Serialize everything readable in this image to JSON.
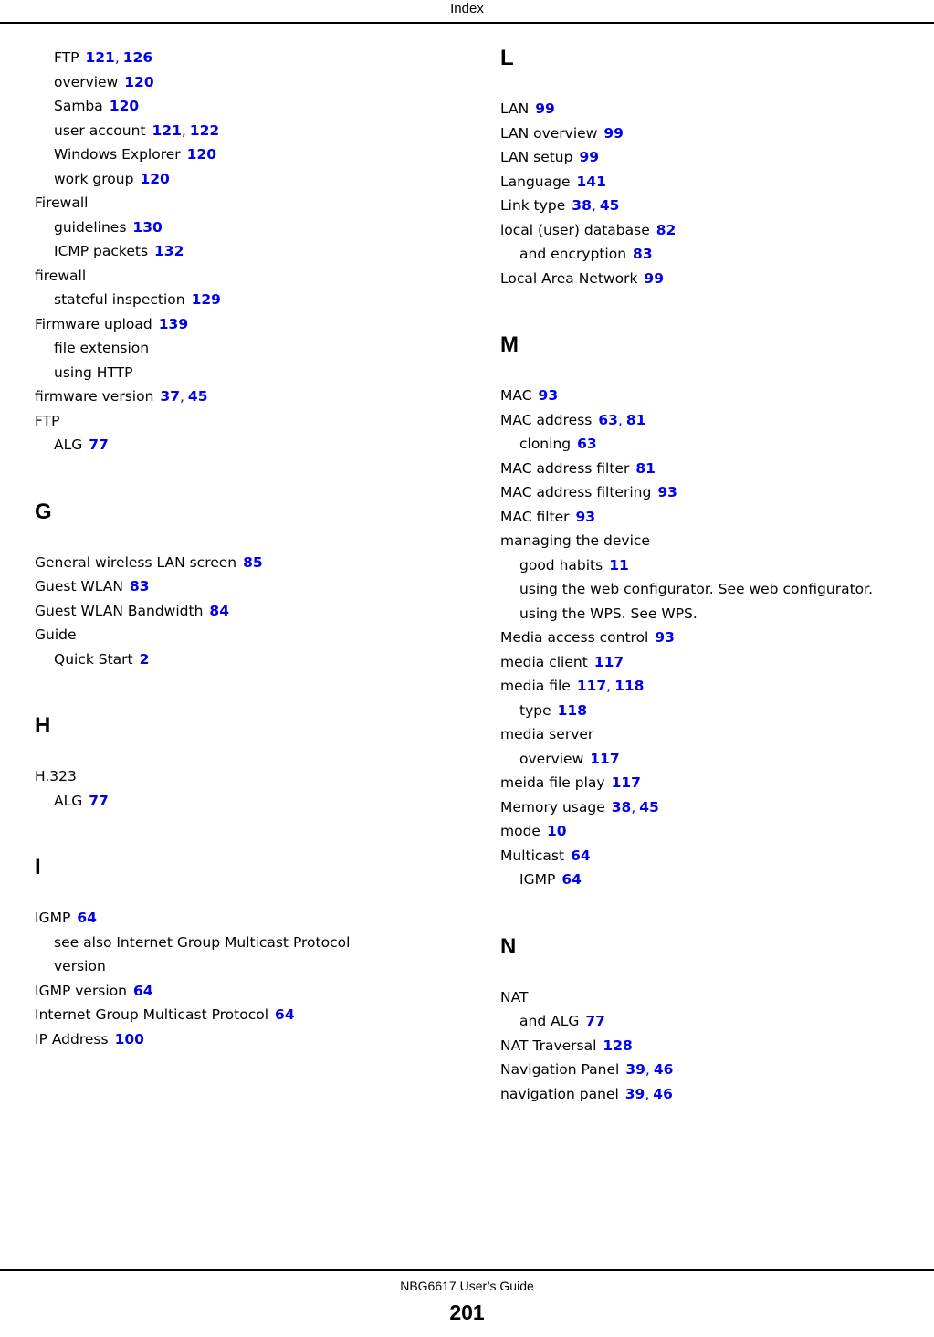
{
  "header": {
    "title": "Index"
  },
  "footer": {
    "guide": "NBG6617 User’s Guide",
    "page_number": "201"
  },
  "colors": {
    "page_link": "#0000ee",
    "text": "#000000",
    "background": "#ffffff"
  },
  "left_column": [
    {
      "type": "entries",
      "items": [
        {
          "level": 1,
          "term": "FTP",
          "pages": [
            "121",
            "126"
          ]
        },
        {
          "level": 1,
          "term": "overview",
          "pages": [
            "120"
          ]
        },
        {
          "level": 1,
          "term": "Samba",
          "pages": [
            "120"
          ]
        },
        {
          "level": 1,
          "term": "user account",
          "pages": [
            "121",
            "122"
          ]
        },
        {
          "level": 1,
          "term": "Windows Explorer",
          "pages": [
            "120"
          ]
        },
        {
          "level": 1,
          "term": "work group",
          "pages": [
            "120"
          ]
        },
        {
          "level": 0,
          "term": "Firewall",
          "pages": []
        },
        {
          "level": 1,
          "term": "guidelines",
          "pages": [
            "130"
          ]
        },
        {
          "level": 1,
          "term": "ICMP packets",
          "pages": [
            "132"
          ]
        },
        {
          "level": 0,
          "term": "firewall",
          "pages": []
        },
        {
          "level": 1,
          "term": "stateful inspection",
          "pages": [
            "129"
          ]
        },
        {
          "level": 0,
          "term": "Firmware upload",
          "pages": [
            "139"
          ]
        },
        {
          "level": 1,
          "term": "file extension",
          "pages": []
        },
        {
          "level": 1,
          "term": "using HTTP",
          "pages": []
        },
        {
          "level": 0,
          "term": "firmware version",
          "pages": [
            "37",
            "45"
          ]
        },
        {
          "level": 0,
          "term": "FTP",
          "pages": []
        },
        {
          "level": 1,
          "term": "ALG",
          "pages": [
            "77"
          ]
        }
      ]
    },
    {
      "type": "section",
      "letter": "G",
      "items": [
        {
          "level": 0,
          "term": "General wireless LAN screen",
          "pages": [
            "85"
          ]
        },
        {
          "level": 0,
          "term": "Guest WLAN",
          "pages": [
            "83"
          ]
        },
        {
          "level": 0,
          "term": "Guest WLAN Bandwidth",
          "pages": [
            "84"
          ]
        },
        {
          "level": 0,
          "term": "Guide",
          "pages": []
        },
        {
          "level": 1,
          "term": "Quick Start",
          "pages": [
            "2"
          ]
        }
      ]
    },
    {
      "type": "section",
      "letter": "H",
      "items": [
        {
          "level": 0,
          "term": "H.323",
          "pages": []
        },
        {
          "level": 1,
          "term": "ALG",
          "pages": [
            "77"
          ]
        }
      ]
    },
    {
      "type": "section",
      "letter": "I",
      "items": [
        {
          "level": 0,
          "term": "IGMP",
          "pages": [
            "64"
          ]
        },
        {
          "level": 1,
          "term": "see also Internet Group Multicast Protocol",
          "pages": []
        },
        {
          "level": 1,
          "term": "version",
          "pages": []
        },
        {
          "level": 0,
          "term": "IGMP version",
          "pages": [
            "64"
          ]
        },
        {
          "level": 0,
          "term": "Internet Group Multicast Protocol",
          "pages": [
            "64"
          ]
        },
        {
          "level": 0,
          "term": "IP Address",
          "pages": [
            "100"
          ]
        }
      ]
    }
  ],
  "right_column": [
    {
      "type": "section",
      "letter": "L",
      "first": true,
      "items": [
        {
          "level": 0,
          "term": "LAN",
          "pages": [
            "99"
          ]
        },
        {
          "level": 0,
          "term": "LAN overview",
          "pages": [
            "99"
          ]
        },
        {
          "level": 0,
          "term": "LAN setup",
          "pages": [
            "99"
          ]
        },
        {
          "level": 0,
          "term": "Language",
          "pages": [
            "141"
          ]
        },
        {
          "level": 0,
          "term": "Link type",
          "pages": [
            "38",
            "45"
          ]
        },
        {
          "level": 0,
          "term": "local (user) database",
          "pages": [
            "82"
          ]
        },
        {
          "level": 1,
          "term": "and encryption",
          "pages": [
            "83"
          ]
        },
        {
          "level": 0,
          "term": "Local Area Network",
          "pages": [
            "99"
          ]
        }
      ]
    },
    {
      "type": "section",
      "letter": "M",
      "items": [
        {
          "level": 0,
          "term": "MAC",
          "pages": [
            "93"
          ]
        },
        {
          "level": 0,
          "term": "MAC address",
          "pages": [
            "63",
            "81"
          ]
        },
        {
          "level": 1,
          "term": "cloning",
          "pages": [
            "63"
          ]
        },
        {
          "level": 0,
          "term": "MAC address filter",
          "pages": [
            "81"
          ]
        },
        {
          "level": 0,
          "term": "MAC address filtering",
          "pages": [
            "93"
          ]
        },
        {
          "level": 0,
          "term": "MAC filter",
          "pages": [
            "93"
          ]
        },
        {
          "level": 0,
          "term": "managing the device",
          "pages": []
        },
        {
          "level": 1,
          "term": "good habits",
          "pages": [
            "11"
          ]
        },
        {
          "level": 1,
          "term": "using the web configurator. See web configurator.",
          "pages": []
        },
        {
          "level": 1,
          "term": "using the WPS. See WPS.",
          "pages": []
        },
        {
          "level": 0,
          "term": "Media access control",
          "pages": [
            "93"
          ]
        },
        {
          "level": 0,
          "term": "media client",
          "pages": [
            "117"
          ]
        },
        {
          "level": 0,
          "term": "media file",
          "pages": [
            "117",
            "118"
          ]
        },
        {
          "level": 1,
          "term": "type",
          "pages": [
            "118"
          ]
        },
        {
          "level": 0,
          "term": "media server",
          "pages": []
        },
        {
          "level": 1,
          "term": "overview",
          "pages": [
            "117"
          ]
        },
        {
          "level": 0,
          "term": "meida file play",
          "pages": [
            "117"
          ]
        },
        {
          "level": 0,
          "term": "Memory usage",
          "pages": [
            "38",
            "45"
          ]
        },
        {
          "level": 0,
          "term": "mode",
          "pages": [
            "10"
          ]
        },
        {
          "level": 0,
          "term": "Multicast",
          "pages": [
            "64"
          ]
        },
        {
          "level": 1,
          "term": "IGMP",
          "pages": [
            "64"
          ]
        }
      ]
    },
    {
      "type": "section",
      "letter": "N",
      "items": [
        {
          "level": 0,
          "term": "NAT",
          "pages": []
        },
        {
          "level": 1,
          "term": "and ALG",
          "pages": [
            "77"
          ]
        },
        {
          "level": 0,
          "term": "NAT Traversal",
          "pages": [
            "128"
          ]
        },
        {
          "level": 0,
          "term": "Navigation Panel",
          "pages": [
            "39",
            "46"
          ]
        },
        {
          "level": 0,
          "term": "navigation panel",
          "pages": [
            "39",
            "46"
          ]
        }
      ]
    }
  ]
}
